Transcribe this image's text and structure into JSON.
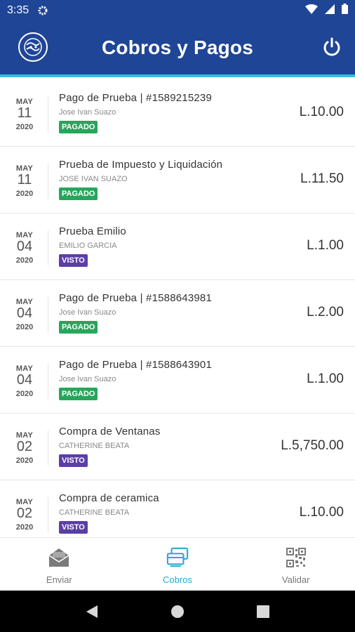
{
  "status_bar": {
    "time": "3:35"
  },
  "header": {
    "title": "Cobros y Pagos"
  },
  "colors": {
    "header_bg": "#1f4596",
    "accent": "#29a7d8",
    "pagado": "#26a65b",
    "visto": "#5b3ea6"
  },
  "transactions": [
    {
      "month": "MAY",
      "day": "11",
      "year": "2020",
      "title": "Pago de Prueba | #1589215239",
      "subtitle": "Jose Ivan Suazo",
      "status": "PAGADO",
      "amount": "L.10.00"
    },
    {
      "month": "MAY",
      "day": "11",
      "year": "2020",
      "title": "Prueba de Impuesto y Liquidación",
      "subtitle": "JOSE IVAN SUAZO",
      "status": "PAGADO",
      "amount": "L.11.50"
    },
    {
      "month": "MAY",
      "day": "04",
      "year": "2020",
      "title": "Prueba Emilio",
      "subtitle": "EMILIO GARCIA",
      "status": "VISTO",
      "amount": "L.1.00"
    },
    {
      "month": "MAY",
      "day": "04",
      "year": "2020",
      "title": "Pago de Prueba | #1588643981",
      "subtitle": "Jose Ivan Suazo",
      "status": "PAGADO",
      "amount": "L.2.00"
    },
    {
      "month": "MAY",
      "day": "04",
      "year": "2020",
      "title": "Pago de Prueba | #1588643901",
      "subtitle": "Jose Ivan Suazo",
      "status": "PAGADO",
      "amount": "L.1.00"
    },
    {
      "month": "MAY",
      "day": "02",
      "year": "2020",
      "title": "Compra de Ventanas",
      "subtitle": "CATHERINE BEATA",
      "status": "VISTO",
      "amount": "L.5,750.00"
    },
    {
      "month": "MAY",
      "day": "02",
      "year": "2020",
      "title": "Compra de ceramica",
      "subtitle": "CATHERINE BEATA",
      "status": "VISTO",
      "amount": "L.10.00"
    }
  ],
  "bottom_nav": [
    {
      "label": "Enviar",
      "icon": "envelope-icon",
      "active": false
    },
    {
      "label": "Cobros",
      "icon": "cards-icon",
      "active": true
    },
    {
      "label": "Validar",
      "icon": "qr-code-icon",
      "active": false
    }
  ]
}
